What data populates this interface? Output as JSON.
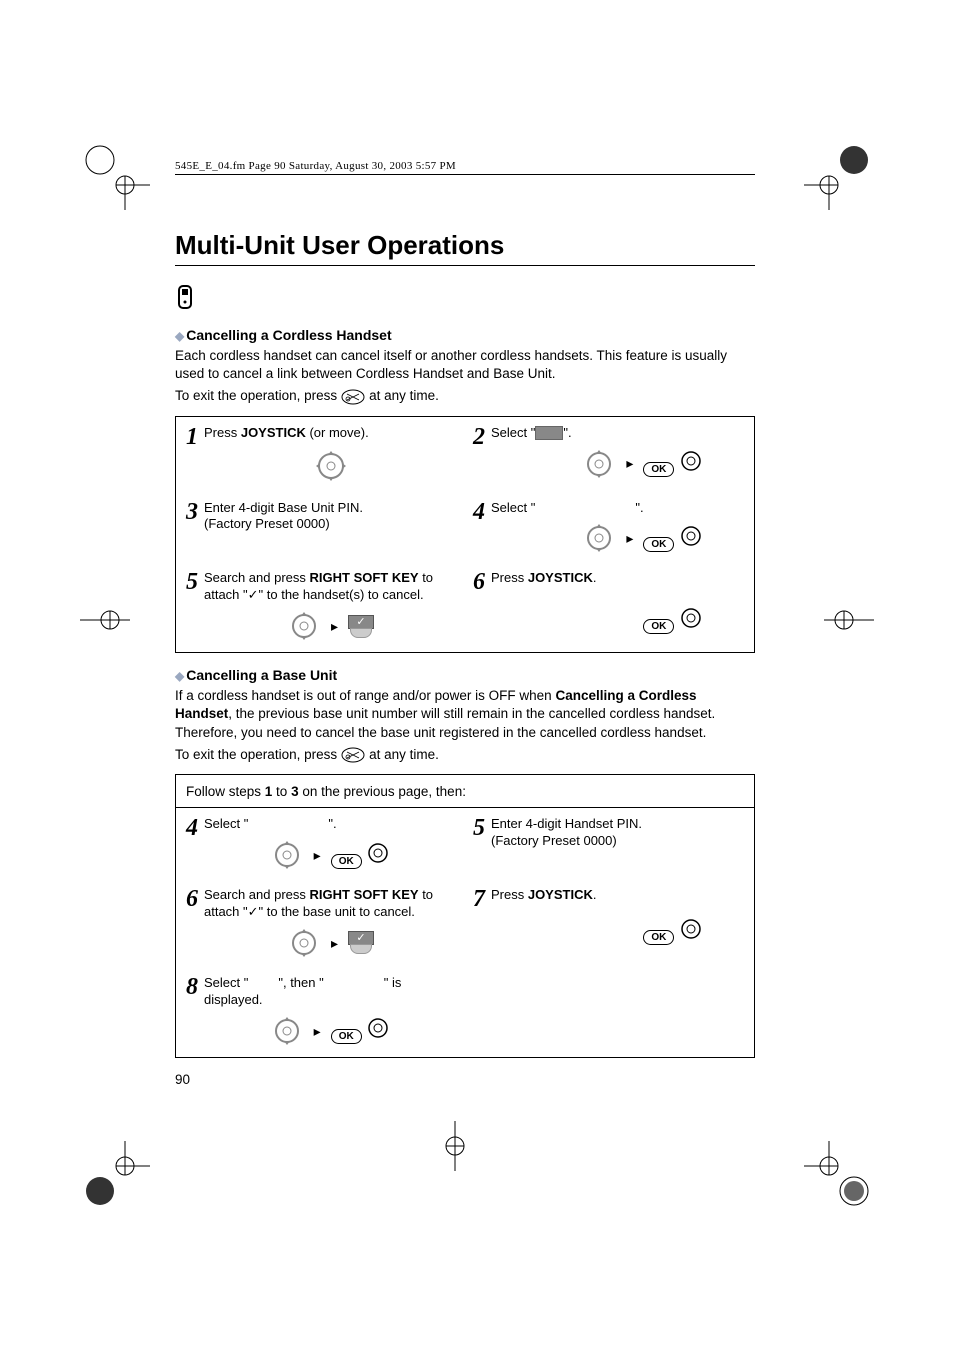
{
  "header": "545E_E_04.fm  Page 90  Saturday, August 30, 2003  5:57 PM",
  "title": "Multi-Unit User Operations",
  "section1": {
    "heading": "Cancelling a Cordless Handset",
    "para": "Each cordless handset can cancel itself or another cordless handsets. This feature is usually used to cancel a link between Cordless Handset and Base Unit.",
    "exit_prefix": "To exit the operation, press",
    "exit_suffix": "at any time."
  },
  "ok_label": "OK",
  "steps1": {
    "s1": {
      "num": "1",
      "pre": "Press ",
      "bold": "JOYSTICK",
      "post": " (or move)."
    },
    "s2": {
      "num": "2",
      "pre": "Select \"",
      "post": "\"."
    },
    "s3": {
      "num": "3",
      "l1": "Enter 4-digit Base Unit PIN.",
      "l2": "(Factory Preset 0000)"
    },
    "s4": {
      "num": "4",
      "pre": "Select \"",
      "post": "\"."
    },
    "s5": {
      "num": "5",
      "pre": "Search and press ",
      "bold": "RIGHT SOFT KEY",
      "post": " to attach \"✓\" to the handset(s) to cancel."
    },
    "s6": {
      "num": "6",
      "pre": "Press ",
      "bold": "JOYSTICK",
      "post": "."
    }
  },
  "section2": {
    "heading": "Cancelling a Base Unit",
    "para_pre": "If a cordless handset is out of range and/or power is OFF when ",
    "para_bold": "Cancelling a Cordless Handset",
    "para_post": ", the previous base unit number will still remain in the cancelled cordless handset. Therefore, you need to cancel the base unit registered in the cancelled cordless handset.",
    "exit_prefix": "To exit the operation, press",
    "exit_suffix": "at any time."
  },
  "follow": {
    "pre": "Follow steps ",
    "b1": "1",
    "mid": " to ",
    "b2": "3",
    "post": " on the previous page, then:"
  },
  "steps2": {
    "s4": {
      "num": "4",
      "pre": "Select \"",
      "post": "\"."
    },
    "s5": {
      "num": "5",
      "l1": "Enter 4-digit Handset PIN.",
      "l2": "(Factory Preset 0000)"
    },
    "s6": {
      "num": "6",
      "pre": "Search and press ",
      "bold": "RIGHT SOFT KEY",
      "post": " to attach \"✓\" to the base unit to cancel."
    },
    "s7": {
      "num": "7",
      "pre": "Press ",
      "bold": "JOYSTICK",
      "post": "."
    },
    "s8": {
      "num": "8",
      "pre": "Select \"",
      "mid": "\", then \"",
      "post": "\" is displayed."
    }
  },
  "pagenum": "90"
}
